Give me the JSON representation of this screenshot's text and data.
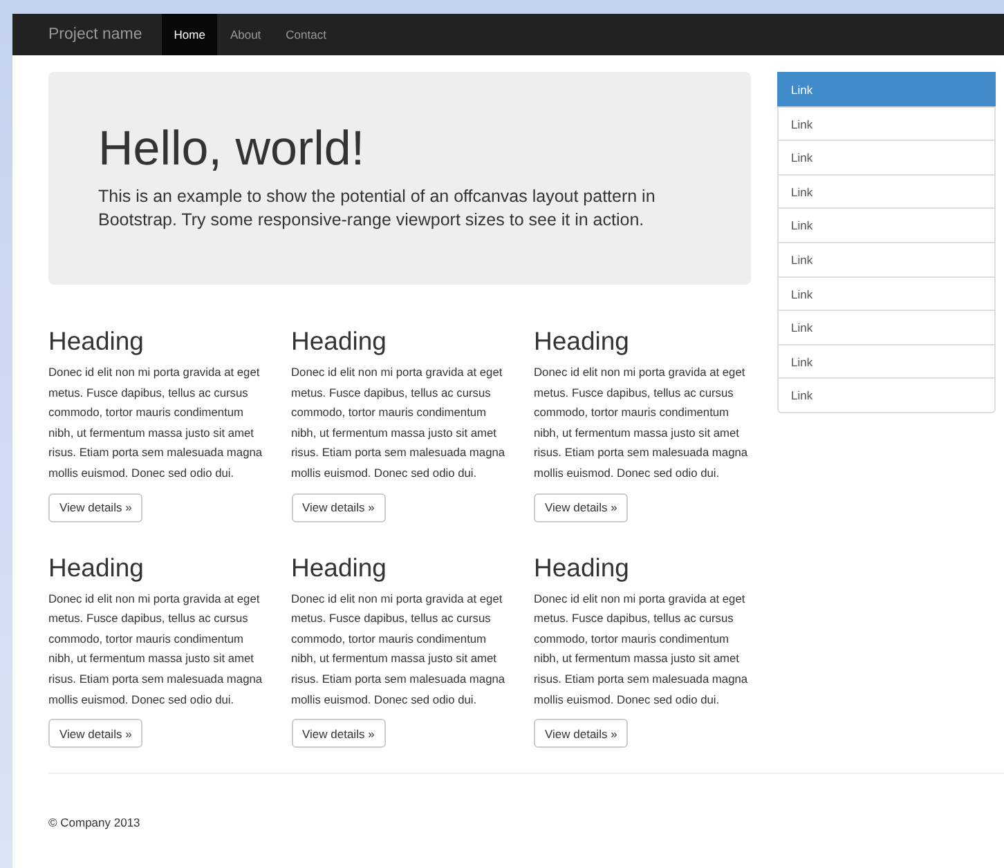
{
  "navbar": {
    "brand": "Project name",
    "items": [
      {
        "label": "Home",
        "selected": true
      },
      {
        "label": "About",
        "selected": false
      },
      {
        "label": "Contact",
        "selected": false
      }
    ]
  },
  "jumbotron": {
    "title": "Hello, world!",
    "text": "This is an example to show the potential of an offcanvas layout pattern in Bootstrap. Try some responsive-range viewport sizes to see it in action."
  },
  "columns": [
    {
      "heading": "Heading",
      "text": "Donec id elit non mi porta gravida at eget metus. Fusce dapibus, tellus ac cursus commodo, tortor mauris condimentum nibh, ut fermentum massa justo sit amet risus. Etiam porta sem malesuada magna mollis euismod. Donec sed odio dui.",
      "button": "View details »"
    },
    {
      "heading": "Heading",
      "text": "Donec id elit non mi porta gravida at eget metus. Fusce dapibus, tellus ac cursus commodo, tortor mauris condimentum nibh, ut fermentum massa justo sit amet risus. Etiam porta sem malesuada magna mollis euismod. Donec sed odio dui.",
      "button": "View details »"
    },
    {
      "heading": "Heading",
      "text": "Donec id elit non mi porta gravida at eget metus. Fusce dapibus, tellus ac cursus commodo, tortor mauris condimentum nibh, ut fermentum massa justo sit amet risus. Etiam porta sem malesuada magna mollis euismod. Donec sed odio dui.",
      "button": "View details »"
    },
    {
      "heading": "Heading",
      "text": "Donec id elit non mi porta gravida at eget metus. Fusce dapibus, tellus ac cursus commodo, tortor mauris condimentum nibh, ut fermentum massa justo sit amet risus. Etiam porta sem malesuada magna mollis euismod. Donec sed odio dui.",
      "button": "View details »"
    },
    {
      "heading": "Heading",
      "text": "Donec id elit non mi porta gravida at eget metus. Fusce dapibus, tellus ac cursus commodo, tortor mauris condimentum nibh, ut fermentum massa justo sit amet risus. Etiam porta sem malesuada magna mollis euismod. Donec sed odio dui.",
      "button": "View details »"
    },
    {
      "heading": "Heading",
      "text": "Donec id elit non mi porta gravida at eget metus. Fusce dapibus, tellus ac cursus commodo, tortor mauris condimentum nibh, ut fermentum massa justo sit amet risus. Etiam porta sem malesuada magna mollis euismod. Donec sed odio dui.",
      "button": "View details »"
    }
  ],
  "sidebar": {
    "items": [
      {
        "label": "Link",
        "selected": true
      },
      {
        "label": "Link",
        "selected": false
      },
      {
        "label": "Link",
        "selected": false
      },
      {
        "label": "Link",
        "selected": false
      },
      {
        "label": "Link",
        "selected": false
      },
      {
        "label": "Link",
        "selected": false
      },
      {
        "label": "Link",
        "selected": false
      },
      {
        "label": "Link",
        "selected": false
      },
      {
        "label": "Link",
        "selected": false
      },
      {
        "label": "Link",
        "selected": false
      }
    ]
  },
  "footer": {
    "text": "© Company 2013"
  }
}
